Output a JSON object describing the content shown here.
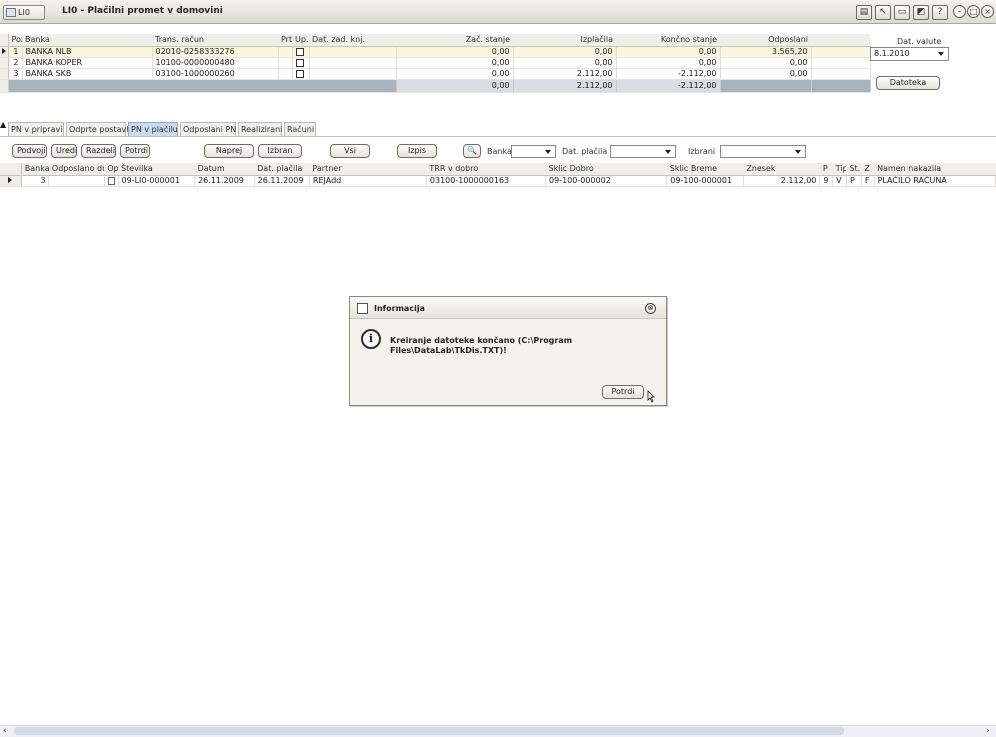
{
  "window": {
    "badge": "LI0",
    "title": "LI0 - Plačilni promet v domovini",
    "buttons": [
      "?",
      "?",
      "?",
      "?",
      "?"
    ],
    "help": "?"
  },
  "top_grid": {
    "columns": [
      "Poz",
      "Banka",
      "Trans. račun",
      "Prt.",
      "Up.",
      "Dat. zad. knj.",
      "Zač. stanje",
      "Izplačila",
      "Končno stanje",
      "Odposlani"
    ],
    "rows": [
      {
        "poz": "1",
        "banka": "BANKA NLB",
        "trans": "02010-0258333276",
        "zac": "0,00",
        "izpl": "0,00",
        "konc": "0,00",
        "odp": "3.565,20"
      },
      {
        "poz": "2",
        "banka": "BANKA KOPER",
        "trans": "10100-0000000480",
        "zac": "0,00",
        "izpl": "0,00",
        "konc": "0,00",
        "odp": "0,00"
      },
      {
        "poz": "3",
        "banka": "BANKA SKB",
        "trans": "03100-1000000260",
        "zac": "0,00",
        "izpl": "2.112,00",
        "konc": "-2.112,00",
        "odp": "0,00"
      }
    ],
    "totals": {
      "zac": "0,00",
      "izpl": "2.112,00",
      "konc": "-2.112,00"
    }
  },
  "dat_valute": {
    "label": "Dat. valute",
    "value": "8.1.2010",
    "button": "Datoteka"
  },
  "tabs": [
    "PN v pripravi",
    "Odprte postavk",
    "PN v plačilu",
    "Odposlani PN",
    "Realizirani",
    "Računi"
  ],
  "toolbar": {
    "podvoji": "Podvoji",
    "uredi": "Uredi",
    "razdeli": "Razdeli",
    "potrdi": "Potrdi",
    "naprej": "Naprej",
    "izbran": "Izbran",
    "vsi": "Vsi",
    "izpis": "Izpis",
    "banka_label": "Banka",
    "dat_placila_label": "Dat. plačila",
    "izbrani_label": "Izbrani"
  },
  "bottom_grid": {
    "columns": [
      "Banka",
      "Odposlano dr",
      "Op",
      "Številka",
      "Datum",
      "Dat. plačila",
      "Partner",
      "TRR v dobro",
      "Sklic Dobro",
      "Sklic Breme",
      "Znesek",
      "P",
      "Tip",
      "St.",
      "Z",
      "Namen nakazila"
    ],
    "rows": [
      {
        "banka": "3",
        "odposlano": "",
        "stevilka": "09-LI0-000001",
        "datum": "26.11.2009",
        "dat_placila": "26.11.2009",
        "partner": "REJAdd",
        "trr": "03100-1000000163",
        "sklic_dobro": "09-100-000002",
        "sklic_breme": "09-100-000001",
        "znesek": "2.112,00",
        "p": "9",
        "tip": "V",
        "st": "P",
        "z": "F",
        "namen": "PLAČILO RAČUNA"
      }
    ]
  },
  "dialog": {
    "title": "Informacija",
    "message": "Kreiranje datoteke končano (C:\\Program Files\\DataLab\\TkDis.TXT)!",
    "confirm": "Potrdi",
    "close": "⊗"
  }
}
